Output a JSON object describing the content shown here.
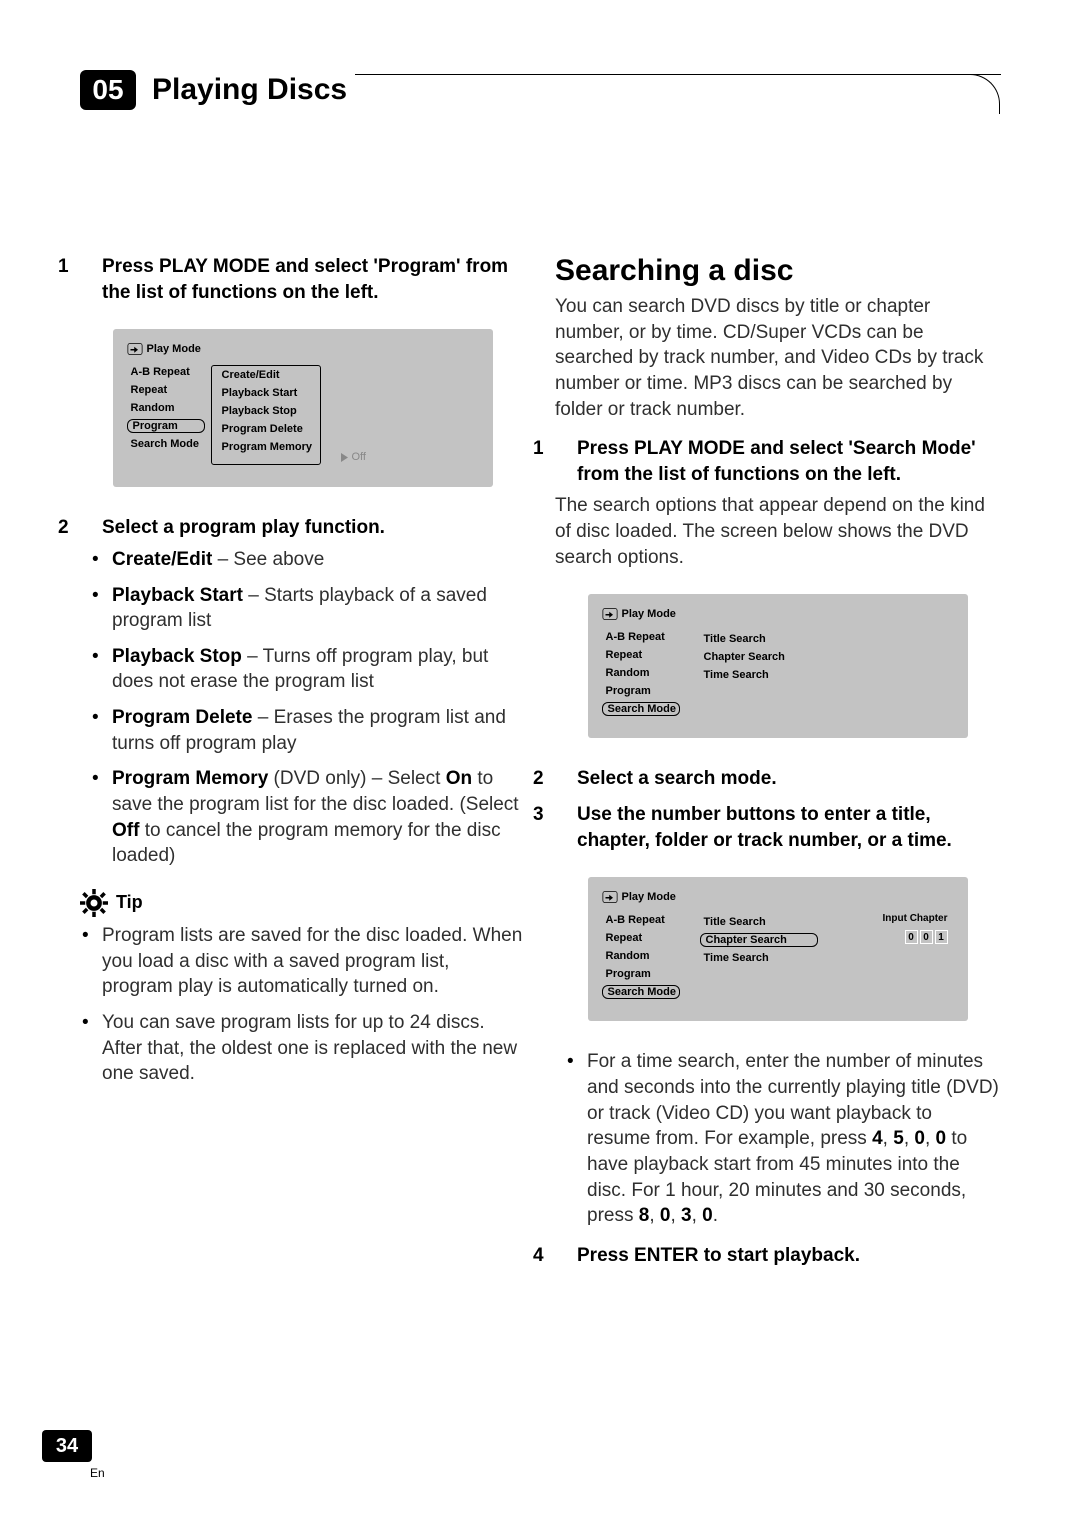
{
  "header": {
    "chapter_number": "05",
    "chapter_title": "Playing Discs"
  },
  "left_column": {
    "step1": "Press PLAY MODE and select 'Program' from the list of functions on the left.",
    "diagram1": {
      "title": "Play Mode",
      "left_items": [
        "A-B Repeat",
        "Repeat",
        "Random",
        "Program",
        "Search Mode"
      ],
      "selected_left": "Program",
      "right_items": [
        "Create/Edit",
        "Playback Start",
        "Playback Stop",
        "Program Delete",
        "Program Memory"
      ],
      "memory_value": "Off"
    },
    "step2_lead": "Select a program play function.",
    "functions": [
      {
        "name": "Create/Edit",
        "desc": " – See above"
      },
      {
        "name": "Playback Start",
        "desc": " – Starts playback of a saved program list"
      },
      {
        "name": "Playback Stop",
        "desc": " – Turns off program play, but does not erase the program list"
      },
      {
        "name": "Program Delete",
        "desc": " – Erases the program list and turns off program play"
      },
      {
        "name": "Program Memory",
        "desc": " (DVD only) – Select ",
        "extra_bold1": "On",
        "extra_after1": " to save the program list for the disc loaded. (Select ",
        "extra_bold2": "Off",
        "extra_after2": " to cancel the program memory for the disc loaded)"
      }
    ],
    "tip_label": "Tip",
    "tips": [
      "Program lists are saved for the disc loaded. When you load a disc with a saved program list, program play is automatically turned on.",
      "You can save program lists for up to 24 discs. After that, the oldest one is replaced with the new one saved."
    ]
  },
  "right_column": {
    "section_title": "Searching a disc",
    "intro": "You can search DVD discs by title or chapter number, or by time. CD/Super VCDs can be searched by track number, and Video CDs by track number or time. MP3 discs can be searched by folder or track number.",
    "step1": "Press PLAY MODE and select 'Search Mode' from the list of functions on the left.",
    "step1_body": "The search options that appear depend on the kind of disc loaded. The screen below shows the DVD search options.",
    "diagram2": {
      "title": "Play Mode",
      "left_items": [
        "A-B Repeat",
        "Repeat",
        "Random",
        "Program",
        "Search Mode"
      ],
      "selected_left": "Search Mode",
      "right_items": [
        "Title Search",
        "Chapter Search",
        "Time Search"
      ]
    },
    "step2": "Select a search mode.",
    "step3": "Use the number buttons to enter a title, chapter, folder or track number, or a time.",
    "diagram3": {
      "title": "Play Mode",
      "left_items": [
        "A-B Repeat",
        "Repeat",
        "Random",
        "Program",
        "Search Mode"
      ],
      "selected_left": "Search Mode",
      "right_items": [
        "Title Search",
        "Chapter Search",
        "Time Search"
      ],
      "selected_right": "Chapter Search",
      "input_label": "Input Chapter",
      "input_digits": [
        "0",
        "0",
        "1"
      ]
    },
    "time_bullet_lead": "For a time search, enter the number of minutes and seconds into the currently playing title (DVD) or track (Video CD) you want playback to resume from. For example, press ",
    "time_digits1": [
      "4",
      "5",
      "0",
      "0"
    ],
    "time_mid": " to have playback start from 45 minutes into the disc. For 1 hour, 20 minutes and 30 seconds, press ",
    "time_digits2": [
      "8",
      "0",
      "3",
      "0"
    ],
    "step4": "Press ENTER to start playback."
  },
  "footer": {
    "page_number": "34",
    "lang": "En"
  }
}
